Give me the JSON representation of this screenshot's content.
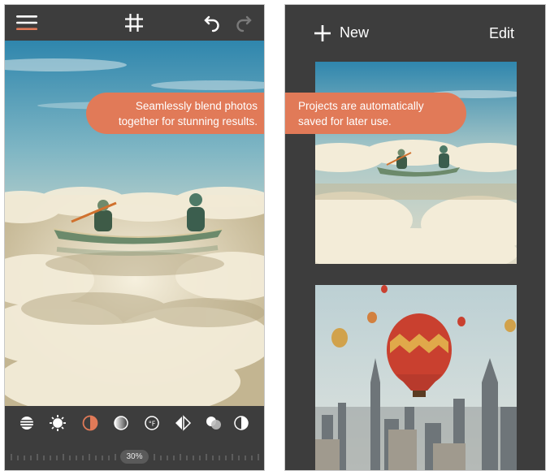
{
  "left_screen": {
    "toolbar": {
      "icons": [
        "menu-icon",
        "grid-icon",
        "undo-icon",
        "redo-icon"
      ]
    },
    "callout": {
      "line1": "Seamlessly blend photos",
      "line2": "together for stunning results."
    },
    "tools": [
      "layers-icon",
      "brightness-icon",
      "exposure-icon",
      "gradient-icon",
      "temperature-icon",
      "flip-icon",
      "blend-icon",
      "contrast-icon"
    ],
    "slider": {
      "value_label": "30%",
      "value": 0.3
    }
  },
  "right_screen": {
    "header": {
      "new_label": "New",
      "edit_label": "Edit"
    },
    "callout": {
      "line1": "Projects are automatically",
      "line2": "saved for later use."
    },
    "projects": [
      "canoe-in-clouds-thumbnail",
      "hot-air-balloons-city-thumbnail"
    ]
  },
  "colors": {
    "background": "#3d3d3d",
    "accent": "#e17a58",
    "text": "#ffffff"
  }
}
